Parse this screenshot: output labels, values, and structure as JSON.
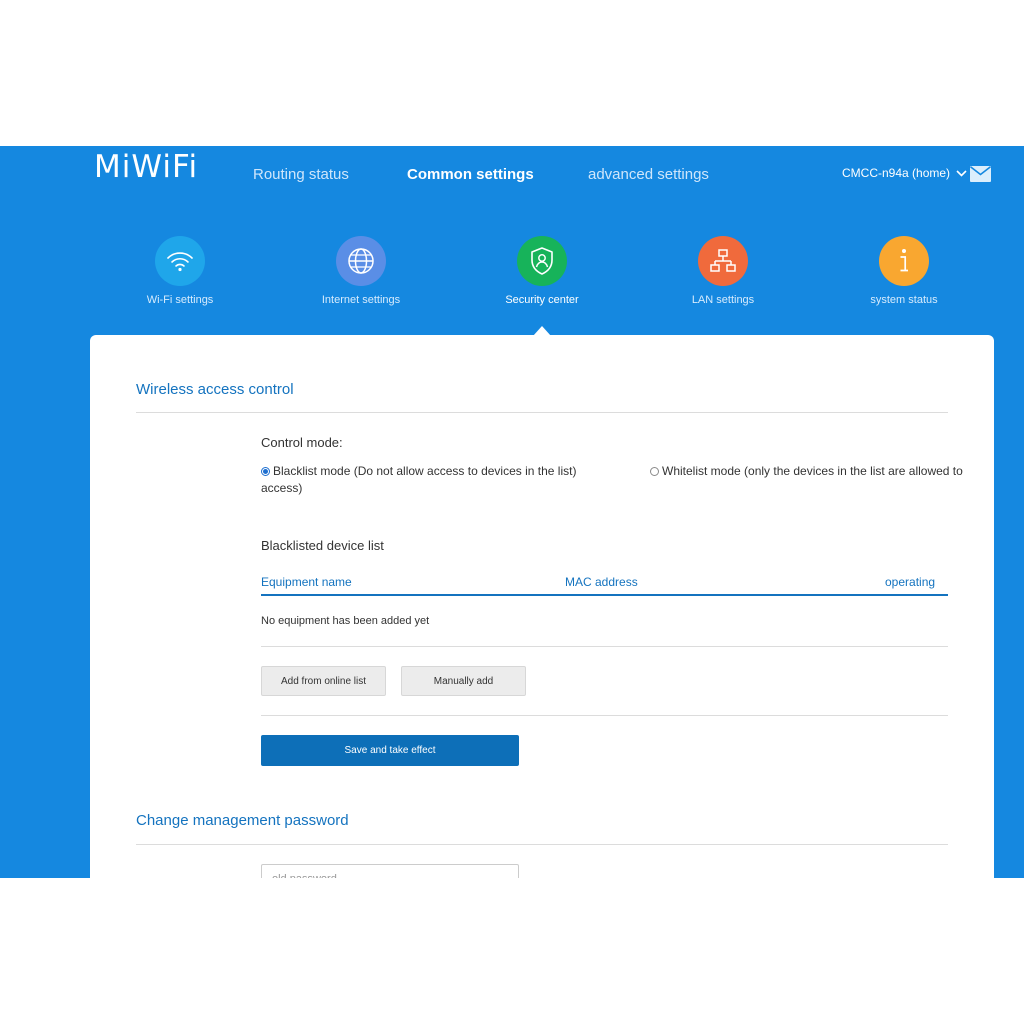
{
  "header": {
    "logo": "MiWiFi",
    "nav": [
      {
        "label": "Routing status"
      },
      {
        "label": "Common settings",
        "active": true
      },
      {
        "label": "advanced settings"
      }
    ],
    "router_name": "CMCC-n94a (home)"
  },
  "tiles": [
    {
      "label": "Wi-Fi settings",
      "icon": "wifi-icon",
      "color": "#1fa6ea"
    },
    {
      "label": "Internet settings",
      "icon": "globe-icon",
      "color": "#5a8ee6"
    },
    {
      "label": "Security center",
      "icon": "shield-icon",
      "color": "#17b35a",
      "active": true
    },
    {
      "label": "LAN settings",
      "icon": "network-icon",
      "color": "#f06a3c"
    },
    {
      "label": "system status",
      "icon": "info-icon",
      "color": "#f9a730"
    }
  ],
  "wireless_access": {
    "title": "Wireless access control",
    "control_mode_label": "Control mode:",
    "blacklist_mode": {
      "line1": "Blacklist mode (Do not allow access to devices in the list)",
      "line2": "access)",
      "checked": true
    },
    "whitelist_mode": {
      "label": "Whitelist mode (only the devices in the list are allowed to",
      "checked": false
    },
    "list_title": "Blacklisted device list",
    "columns": [
      "Equipment name",
      "MAC address",
      "operating"
    ],
    "empty_text": "No equipment has been added yet",
    "add_online_label": "Add from online list",
    "manual_add_label": "Manually add",
    "save_label": "Save and take effect"
  },
  "password": {
    "title": "Change management password",
    "old_password_placeholder": "old password"
  },
  "colors": {
    "header_bg": "#1588e0",
    "accent": "#1473bf",
    "primary_button": "#0d6fb8"
  }
}
